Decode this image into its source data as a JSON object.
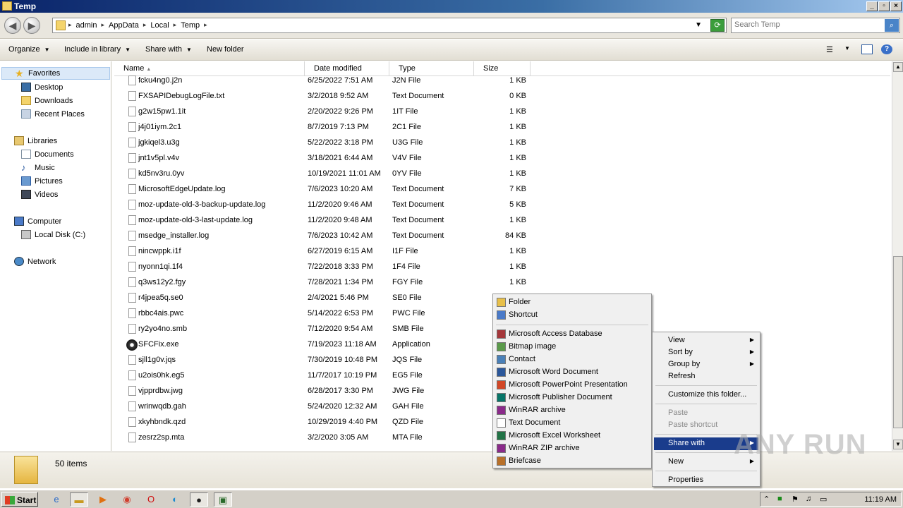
{
  "window": {
    "title": "Temp"
  },
  "address": {
    "crumbs": [
      "admin",
      "AppData",
      "Local",
      "Temp"
    ],
    "search_placeholder": "Search Temp"
  },
  "toolbar": {
    "organize": "Organize",
    "include_in_library": "Include in library",
    "share_with": "Share with",
    "new_folder": "New folder"
  },
  "nav": {
    "favorites": "Favorites",
    "desktop": "Desktop",
    "downloads": "Downloads",
    "recent_places": "Recent Places",
    "libraries": "Libraries",
    "documents": "Documents",
    "music": "Music",
    "pictures": "Pictures",
    "videos": "Videos",
    "computer": "Computer",
    "local_disk": "Local Disk (C:)",
    "network": "Network"
  },
  "columns": {
    "name": "Name",
    "date": "Date modified",
    "type": "Type",
    "size": "Size"
  },
  "files": [
    {
      "name": "fcku4ng0.j2n",
      "date": "6/25/2022 7:51 AM",
      "type": "J2N File",
      "size": "1 KB"
    },
    {
      "name": "FXSAPIDebugLogFile.txt",
      "date": "3/2/2018 9:52 AM",
      "type": "Text Document",
      "size": "0 KB"
    },
    {
      "name": "g2w15pw1.1it",
      "date": "2/20/2022 9:26 PM",
      "type": "1IT File",
      "size": "1 KB"
    },
    {
      "name": "j4j01iym.2c1",
      "date": "8/7/2019 7:13 PM",
      "type": "2C1 File",
      "size": "1 KB"
    },
    {
      "name": "jgkiqel3.u3g",
      "date": "5/22/2022 3:18 PM",
      "type": "U3G File",
      "size": "1 KB"
    },
    {
      "name": "jnt1v5pl.v4v",
      "date": "3/18/2021 6:44 AM",
      "type": "V4V File",
      "size": "1 KB"
    },
    {
      "name": "kd5nv3ru.0yv",
      "date": "10/19/2021 11:01 AM",
      "type": "0YV File",
      "size": "1 KB"
    },
    {
      "name": "MicrosoftEdgeUpdate.log",
      "date": "7/6/2023 10:20 AM",
      "type": "Text Document",
      "size": "7 KB"
    },
    {
      "name": "moz-update-old-3-backup-update.log",
      "date": "11/2/2020 9:46 AM",
      "type": "Text Document",
      "size": "5 KB"
    },
    {
      "name": "moz-update-old-3-last-update.log",
      "date": "11/2/2020 9:48 AM",
      "type": "Text Document",
      "size": "1 KB"
    },
    {
      "name": "msedge_installer.log",
      "date": "7/6/2023 10:42 AM",
      "type": "Text Document",
      "size": "84 KB"
    },
    {
      "name": "nincwppk.i1f",
      "date": "6/27/2019 6:15 AM",
      "type": "I1F File",
      "size": "1 KB"
    },
    {
      "name": "nyonn1qi.1f4",
      "date": "7/22/2018 3:33 PM",
      "type": "1F4 File",
      "size": "1 KB"
    },
    {
      "name": "q3ws12y2.fgy",
      "date": "7/28/2021 1:34 PM",
      "type": "FGY File",
      "size": "1 KB"
    },
    {
      "name": "r4jpea5q.se0",
      "date": "2/4/2021 5:46 PM",
      "type": "SE0 File",
      "size": ""
    },
    {
      "name": "rbbc4ais.pwc",
      "date": "5/14/2022 6:53 PM",
      "type": "PWC File",
      "size": ""
    },
    {
      "name": "ry2yo4no.smb",
      "date": "7/12/2020 9:54 AM",
      "type": "SMB File",
      "size": ""
    },
    {
      "name": "SFCFix.exe",
      "date": "7/19/2023 11:18 AM",
      "type": "Application",
      "size": "",
      "app": true
    },
    {
      "name": "sjll1g0v.jqs",
      "date": "7/30/2019 10:48 PM",
      "type": "JQS File",
      "size": ""
    },
    {
      "name": "u2ois0hk.eg5",
      "date": "11/7/2017 10:19 PM",
      "type": "EG5 File",
      "size": ""
    },
    {
      "name": "vjpprdbw.jwg",
      "date": "6/28/2017 3:30 PM",
      "type": "JWG File",
      "size": ""
    },
    {
      "name": "wrinwqdb.gah",
      "date": "5/24/2020 12:32 AM",
      "type": "GAH File",
      "size": ""
    },
    {
      "name": "xkyhbndk.qzd",
      "date": "10/29/2019 4:40 PM",
      "type": "QZD File",
      "size": ""
    },
    {
      "name": "zesrz2sp.mta",
      "date": "3/2/2020 3:05 AM",
      "type": "MTA File",
      "size": ""
    }
  ],
  "details": {
    "count": "50 items"
  },
  "context_menu": {
    "view": "View",
    "sort_by": "Sort by",
    "group_by": "Group by",
    "refresh": "Refresh",
    "customize": "Customize this folder...",
    "paste": "Paste",
    "paste_shortcut": "Paste shortcut",
    "share_with": "Share with",
    "new": "New",
    "properties": "Properties"
  },
  "new_menu": [
    {
      "label": "Folder",
      "icon": "folder-icon",
      "color": "#e8c04a"
    },
    {
      "label": "Shortcut",
      "icon": "shortcut-icon",
      "color": "#4a7ac8"
    },
    {
      "label": "Microsoft Access Database",
      "icon": "access-icon",
      "color": "#a4373a"
    },
    {
      "label": "Bitmap image",
      "icon": "bitmap-icon",
      "color": "#5a9a4a"
    },
    {
      "label": "Contact",
      "icon": "contact-icon",
      "color": "#4a80b8"
    },
    {
      "label": "Microsoft Word Document",
      "icon": "word-icon",
      "color": "#2b579a"
    },
    {
      "label": "Microsoft PowerPoint Presentation",
      "icon": "powerpoint-icon",
      "color": "#d24726"
    },
    {
      "label": "Microsoft Publisher Document",
      "icon": "publisher-icon",
      "color": "#077568"
    },
    {
      "label": "WinRAR archive",
      "icon": "winrar-icon",
      "color": "#8a2a8a"
    },
    {
      "label": "Text Document",
      "icon": "text-document-icon",
      "color": "#ffffff"
    },
    {
      "label": "Microsoft Excel Worksheet",
      "icon": "excel-icon",
      "color": "#217346"
    },
    {
      "label": "WinRAR ZIP archive",
      "icon": "winrar-zip-icon",
      "color": "#8a2a8a"
    },
    {
      "label": "Briefcase",
      "icon": "briefcase-icon",
      "color": "#b8702a"
    }
  ],
  "taskbar": {
    "start": "Start",
    "clock": "11:19 AM"
  },
  "watermark": "ANY RUN"
}
